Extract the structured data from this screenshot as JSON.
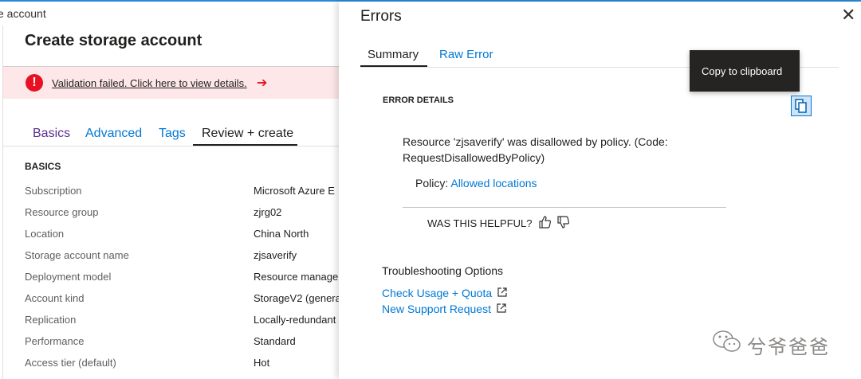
{
  "breadcrumb": "e account",
  "blade": {
    "title": "Create storage account",
    "validation_message": "Validation failed. Click here to view details.",
    "error_glyph": "!",
    "arrow_glyph": "➔",
    "tabs": [
      "Basics",
      "Advanced",
      "Tags",
      "Review + create"
    ],
    "active_tab": "Review + create",
    "section_title": "BASICS",
    "rows": [
      {
        "label": "Subscription",
        "value": "Microsoft Azure E"
      },
      {
        "label": "Resource group",
        "value": "zjrg02"
      },
      {
        "label": "Location",
        "value": "China North"
      },
      {
        "label": "Storage account name",
        "value": "zjsaverify"
      },
      {
        "label": "Deployment model",
        "value": "Resource manage"
      },
      {
        "label": "Account kind",
        "value": "StorageV2 (genera"
      },
      {
        "label": "Replication",
        "value": "Locally-redundant"
      },
      {
        "label": "Performance",
        "value": "Standard"
      },
      {
        "label": "Access tier (default)",
        "value": "Hot"
      }
    ]
  },
  "errors_panel": {
    "title": "Errors",
    "close_glyph": "✕",
    "tabs": [
      "Summary",
      "Raw Error"
    ],
    "active_tab": "Summary",
    "tooltip": "Copy to clipboard",
    "error_details_label": "ERROR DETAILS",
    "error_message": "Resource 'zjsaverify' was disallowed by policy. (Code: RequestDisallowedByPolicy)",
    "policy_label": "Policy:",
    "policy_link": "Allowed locations",
    "helpful_label": "WAS THIS HELPFUL?",
    "troubleshooting_title": "Troubleshooting Options",
    "links": [
      "Check Usage + Quota",
      "New Support Request"
    ]
  },
  "watermark": "兮爷爸爸",
  "colors": {
    "accent": "#0078d4",
    "error": "#e81123",
    "banner_bg": "#fde7e9",
    "basics_tab": "#5c2e91"
  }
}
